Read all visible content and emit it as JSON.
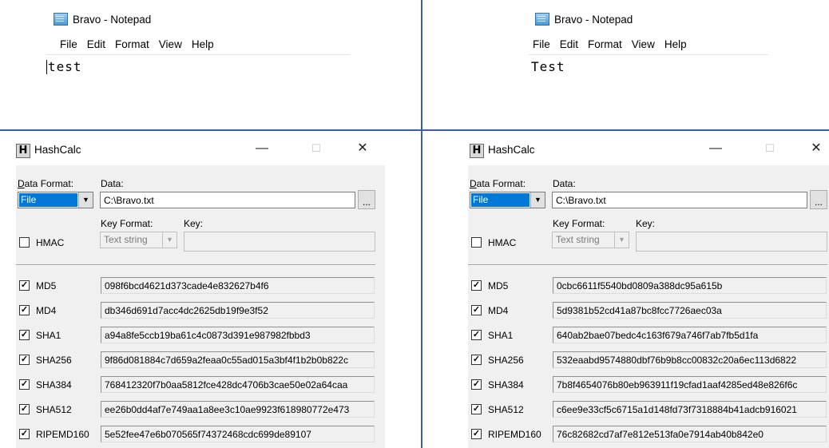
{
  "notepad": {
    "title": "Bravo - Notepad",
    "menu": [
      "File",
      "Edit",
      "Format",
      "View",
      "Help"
    ]
  },
  "hashcalc": {
    "title": "HashCalc",
    "controls": {
      "minimize": "—",
      "maximize": "☐",
      "close": "✕"
    },
    "data_format_label": "Data Format:",
    "data_format_value": "File",
    "data_label": "Data:",
    "data_value": "C:\\Bravo.txt",
    "browse_label": "...",
    "key_format_label": "Key Format:",
    "key_format_value": "Text string",
    "key_label": "Key:",
    "hmac_label": "HMAC",
    "check": "✓"
  },
  "left": {
    "notepad_text": "test",
    "hashes": [
      {
        "name": "MD5",
        "value": "098f6bcd4621d373cade4e832627b4f6"
      },
      {
        "name": "MD4",
        "value": "db346d691d7acc4dc2625db19f9e3f52"
      },
      {
        "name": "SHA1",
        "value": "a94a8fe5ccb19ba61c4c0873d391e987982fbbd3"
      },
      {
        "name": "SHA256",
        "value": "9f86d081884c7d659a2feaa0c55ad015a3bf4f1b2b0b822c"
      },
      {
        "name": "SHA384",
        "value": "768412320f7b0aa5812fce428dc4706b3cae50e02a64caa"
      },
      {
        "name": "SHA512",
        "value": "ee26b0dd4af7e749aa1a8ee3c10ae9923f618980772e473"
      },
      {
        "name": "RIPEMD160",
        "value": "5e52fee47e6b070565f74372468cdc699de89107"
      }
    ]
  },
  "right": {
    "notepad_text": "Test",
    "hashes": [
      {
        "name": "MD5",
        "value": "0cbc6611f5540bd0809a388dc95a615b"
      },
      {
        "name": "MD4",
        "value": "5d9381b52cd41a87bc8fcc7726aec03a"
      },
      {
        "name": "SHA1",
        "value": "640ab2bae07bedc4c163f679a746f7ab7fb5d1fa"
      },
      {
        "name": "SHA256",
        "value": "532eaabd9574880dbf76b9b8cc00832c20a6ec113d6822"
      },
      {
        "name": "SHA384",
        "value": "7b8f4654076b80eb963911f19cfad1aaf4285ed48e826f6c"
      },
      {
        "name": "SHA512",
        "value": "c6ee9e33cf5c6715a1d148fd73f7318884b41adcb916021"
      },
      {
        "name": "RIPEMD160",
        "value": "76c82682cd7af7e812e513fa0e7914ab40b842e0"
      }
    ]
  }
}
